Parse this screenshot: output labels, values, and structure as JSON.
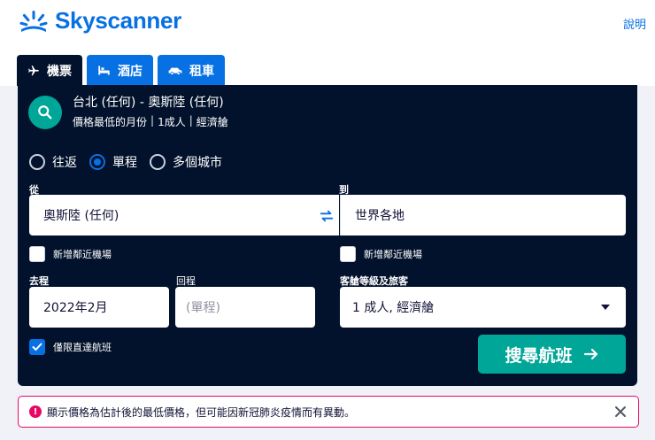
{
  "header": {
    "logo_text": "Skyscanner",
    "help_link": "說明"
  },
  "tabs": [
    {
      "label": "機票",
      "icon": "airplane-icon",
      "active": true
    },
    {
      "label": "酒店",
      "icon": "bed-icon",
      "active": false
    },
    {
      "label": "租車",
      "icon": "car-icon",
      "active": false
    }
  ],
  "summary": {
    "route": "台北 (任何) - 奧斯陸 (任何)",
    "details": [
      "價格最低的月份",
      "1成人",
      "經濟艙"
    ],
    "separator": "|"
  },
  "trip_types": [
    {
      "label": "往返",
      "selected": false
    },
    {
      "label": "單程",
      "selected": true
    },
    {
      "label": "多個城市",
      "selected": false
    }
  ],
  "form": {
    "from_label": "從",
    "from_value": "奧斯陸 (任何)",
    "to_label": "到",
    "to_value": "世界各地",
    "from_nearby_label": "新增鄰近機場",
    "to_nearby_label": "新增鄰近機場",
    "depart_label": "去程",
    "depart_value": "2022年2月",
    "return_label": "回程",
    "return_placeholder": "(單程)",
    "cabin_label": "客艙等級及旅客",
    "cabin_value": "1 成人, 經濟艙",
    "direct_only_label": "僅限直達航班",
    "direct_only_checked": true,
    "search_button": "搜尋航班"
  },
  "notice": {
    "text": "顯示價格為估計後的最低價格，但可能因新冠肺炎疫情而有異動。"
  },
  "colors": {
    "brand_blue": "#0770e3",
    "panel_navy": "#02122c",
    "accent_teal": "#00a698",
    "alert_red": "#e70866"
  }
}
